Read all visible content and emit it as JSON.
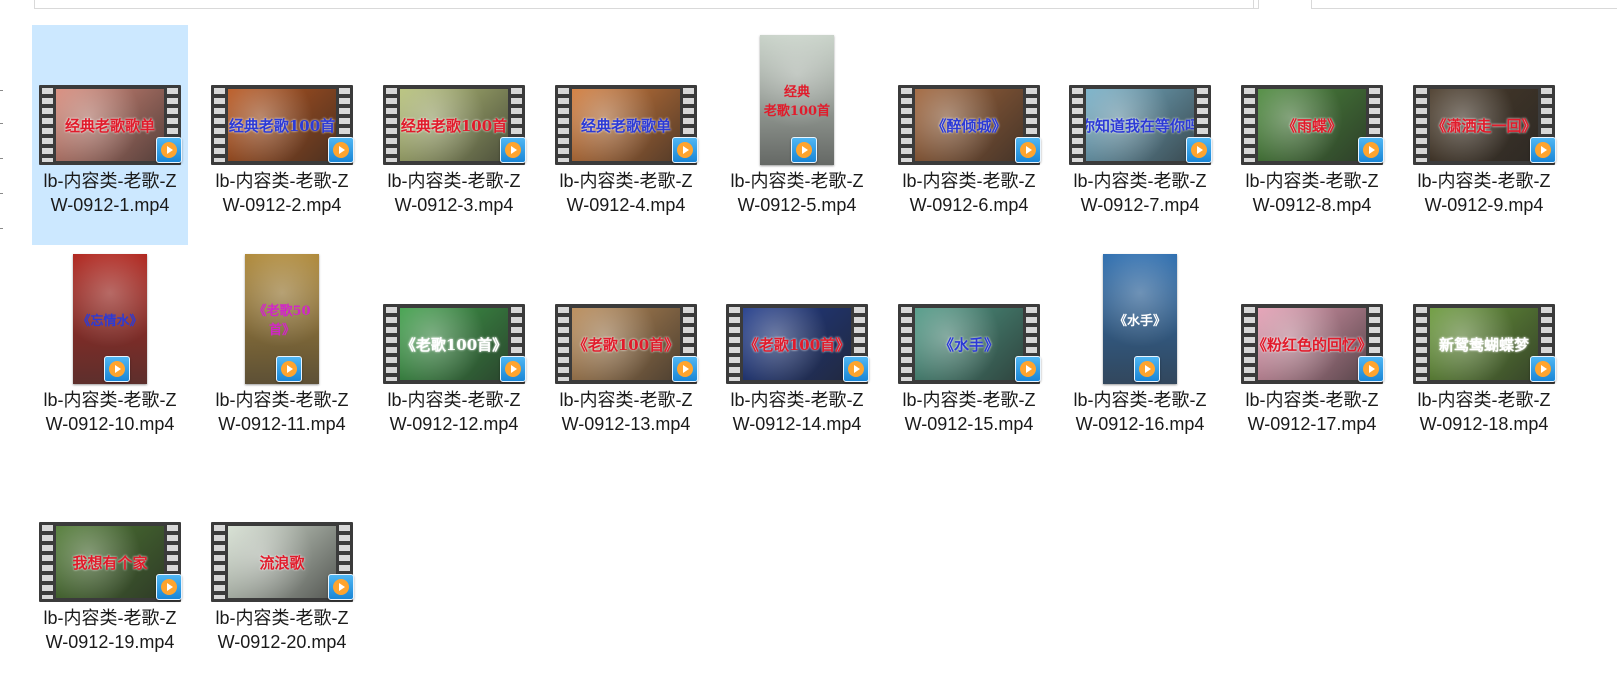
{
  "files": [
    {
      "name": "lb-内容类-老歌-ZW-0912-1.mp4",
      "shape": "film",
      "overlay": "经典老歌歌单",
      "bg": "#d88a7a",
      "fg": "#e11b2b",
      "selected": true
    },
    {
      "name": "lb-内容类-老歌-ZW-0912-2.mp4",
      "shape": "film",
      "overlay": "经典老歌100首",
      "bg": "#b9561e",
      "fg": "#2c3ad6",
      "selected": false
    },
    {
      "name": "lb-内容类-老歌-ZW-0912-3.mp4",
      "shape": "film",
      "overlay": "经典老歌100首",
      "bg": "#b7c27a",
      "fg": "#e11b2b",
      "selected": false
    },
    {
      "name": "lb-内容类-老歌-ZW-0912-4.mp4",
      "shape": "film",
      "overlay": "经典老歌歌单",
      "bg": "#d27b3a",
      "fg": "#2c3ad6",
      "selected": false
    },
    {
      "name": "lb-内容类-老歌-ZW-0912-5.mp4",
      "shape": "portrait",
      "overlay": "经典\n老歌100首",
      "bg": "#c9d3c9",
      "fg": "#e11b2b",
      "selected": false
    },
    {
      "name": "lb-内容类-老歌-ZW-0912-6.mp4",
      "shape": "film",
      "overlay": "《醉倾城》",
      "bg": "#a0643a",
      "fg": "#2c3ad6",
      "selected": false
    },
    {
      "name": "lb-内容类-老歌-ZW-0912-7.mp4",
      "shape": "film",
      "overlay": "你知道我在等你吗",
      "bg": "#76b0c8",
      "fg": "#2c3ad6",
      "selected": false
    },
    {
      "name": "lb-内容类-老歌-ZW-0912-8.mp4",
      "shape": "film",
      "overlay": "《雨蝶》",
      "bg": "#4c8a3c",
      "fg": "#e11b2b",
      "selected": false
    },
    {
      "name": "lb-内容类-老歌-ZW-0912-9.mp4",
      "shape": "film",
      "overlay": "《潇洒走一回》",
      "bg": "#4a3b2a",
      "fg": "#e11b2b",
      "selected": false
    },
    {
      "name": "lb-内容类-老歌-ZW-0912-10.mp4",
      "shape": "portrait",
      "overlay": "《忘情水》",
      "bg": "#b1271f",
      "fg": "#2c3ad6",
      "selected": false
    },
    {
      "name": "lb-内容类-老歌-ZW-0912-11.mp4",
      "shape": "portrait",
      "overlay": "《老歌50首》",
      "bg": "#b08a3a",
      "fg": "#d126c8",
      "selected": false
    },
    {
      "name": "lb-内容类-老歌-ZW-0912-12.mp4",
      "shape": "film",
      "overlay": "《老歌100首》",
      "bg": "#3fa04a",
      "fg": "#ffffff",
      "selected": false
    },
    {
      "name": "lb-内容类-老歌-ZW-0912-13.mp4",
      "shape": "film",
      "overlay": "《老歌100首》",
      "bg": "#b98a56",
      "fg": "#e11b2b",
      "selected": false
    },
    {
      "name": "lb-内容类-老歌-ZW-0912-14.mp4",
      "shape": "film",
      "overlay": "《老歌100首》",
      "bg": "#1f3a8a",
      "fg": "#e11b2b",
      "selected": false
    },
    {
      "name": "lb-内容类-老歌-ZW-0912-15.mp4",
      "shape": "film",
      "overlay": "《水手》",
      "bg": "#4f9a86",
      "fg": "#2c3ad6",
      "selected": false
    },
    {
      "name": "lb-内容类-老歌-ZW-0912-16.mp4",
      "shape": "portrait",
      "overlay": "《水手》",
      "bg": "#2f6fb0",
      "fg": "#ffffff",
      "selected": false
    },
    {
      "name": "lb-内容类-老歌-ZW-0912-17.mp4",
      "shape": "film",
      "overlay": "《粉红色的回忆》",
      "bg": "#e59fb4",
      "fg": "#e11b2b",
      "selected": false
    },
    {
      "name": "lb-内容类-老歌-ZW-0912-18.mp4",
      "shape": "film",
      "overlay": "新鸳鸯蝴蝶梦",
      "bg": "#6a9a3a",
      "fg": "#ffffff",
      "selected": false
    },
    {
      "name": "lb-内容类-老歌-ZW-0912-19.mp4",
      "shape": "film",
      "overlay": "我想有个家",
      "bg": "#4f7a33",
      "fg": "#e11b2b",
      "selected": false
    },
    {
      "name": "lb-内容类-老歌-ZW-0912-20.mp4",
      "shape": "film",
      "overlay": "流浪歌",
      "bg": "#d6e0d2",
      "fg": "#e11b2b",
      "selected": false
    }
  ]
}
